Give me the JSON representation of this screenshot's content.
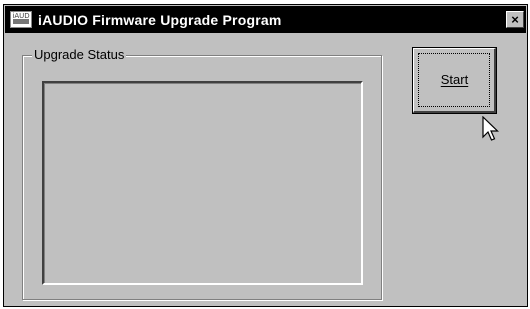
{
  "window": {
    "title": "iAUDIO Firmware Upgrade Program",
    "icon_text": "iAUD",
    "close_label": "×"
  },
  "group": {
    "label": "Upgrade Status",
    "status_text": ""
  },
  "actions": {
    "start_label": "Start"
  },
  "icons": {
    "app": "iaudio-app-icon",
    "close": "close-icon",
    "cursor": "mouse-pointer-icon"
  },
  "colors": {
    "window_bg": "#c0c0c0",
    "titlebar_bg": "#000000",
    "title_text": "#ffffff"
  }
}
